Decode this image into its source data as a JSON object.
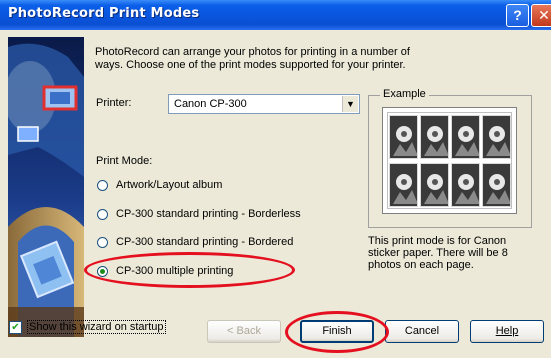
{
  "window": {
    "title": "PhotoRecord Print Modes"
  },
  "titlebar": {
    "help_glyph": "?",
    "close_glyph": "✕"
  },
  "intro": "PhotoRecord can arrange your photos for printing in a number of ways. Choose one of the print modes supported for your printer.",
  "printer": {
    "label": "Printer:",
    "value": "Canon CP-300"
  },
  "example": {
    "label": "Example"
  },
  "print_mode": {
    "label": "Print Mode:",
    "options": [
      {
        "label": "Artwork/Layout album",
        "selected": false
      },
      {
        "label": "CP-300 standard printing - Borderless",
        "selected": false
      },
      {
        "label": "CP-300 standard printing - Bordered",
        "selected": false
      },
      {
        "label": "CP-300 multiple printing",
        "selected": true
      }
    ]
  },
  "description": "This print mode is for Canon sticker paper. There will be 8 photos on each page.",
  "wizard_checkbox": {
    "label": "Show this wizard on startup",
    "checked": true,
    "check_glyph": "✔"
  },
  "buttons": {
    "back": {
      "label": "< Back",
      "enabled": false
    },
    "finish": {
      "label": "Finish"
    },
    "cancel": {
      "label": "Cancel"
    },
    "help": {
      "label": "Help"
    }
  },
  "colors": {
    "annotation": "#e4101f",
    "title_bar": "#0a56de"
  }
}
